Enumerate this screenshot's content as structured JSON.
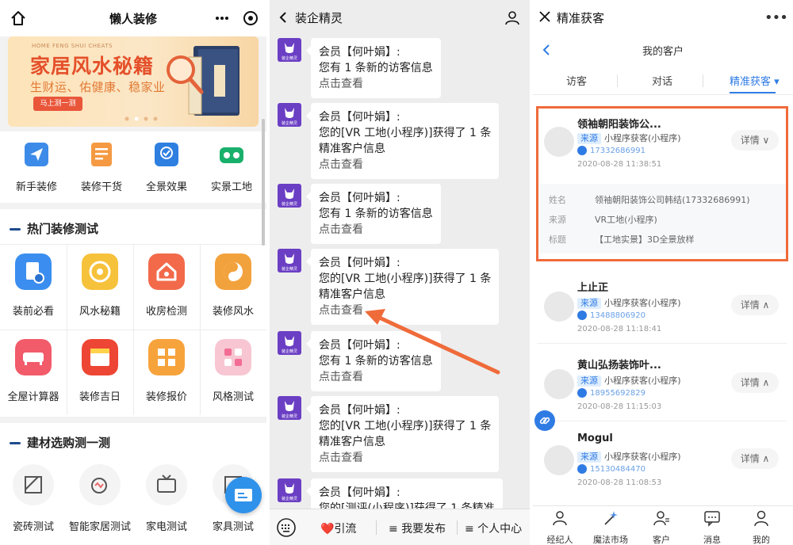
{
  "colors": {
    "accent_blue": "#2f7be4",
    "highlight_orange": "#ef6b3a",
    "banner_red": "#e4502a",
    "chat_avatar": "#6b3fc4"
  },
  "panel1": {
    "title": "懒人装修",
    "banner": {
      "small_text": "HOME FENG SHUI CHEATS",
      "title": "家居风水秘籍",
      "subtitle": "生财运、佑健康、稳家业",
      "button": "马上测一测"
    },
    "quick_links": [
      {
        "label": "新手装修",
        "icon": "paper-plane-icon"
      },
      {
        "label": "装修干货",
        "icon": "document-icon"
      },
      {
        "label": "全景效果",
        "icon": "panorama-icon"
      },
      {
        "label": "实景工地",
        "icon": "vr-glasses-icon"
      }
    ],
    "section1": {
      "title": "热门装修测试",
      "items": [
        {
          "label": "装前必看",
          "icon": "checklist-icon"
        },
        {
          "label": "风水秘籍",
          "icon": "compass-icon"
        },
        {
          "label": "收房检测",
          "icon": "house-icon"
        },
        {
          "label": "装修风水",
          "icon": "yinyang-icon"
        },
        {
          "label": "全屋计算器",
          "icon": "sofa-icon"
        },
        {
          "label": "装修吉日",
          "icon": "calendar-icon"
        },
        {
          "label": "装修报价",
          "icon": "calculator-icon"
        },
        {
          "label": "风格测试",
          "icon": "grid-icon"
        }
      ]
    },
    "section2": {
      "title": "建材选购测一测",
      "items": [
        {
          "label": "瓷砖测试",
          "icon": "tile-icon"
        },
        {
          "label": "智能家居测试",
          "icon": "smart-home-icon"
        },
        {
          "label": "家电测试",
          "icon": "tv-icon"
        },
        {
          "label": "家具测试",
          "icon": "furniture-icon"
        }
      ]
    }
  },
  "panel2": {
    "title": "装企精灵",
    "avatar_label": "装企精灵",
    "messages": [
      {
        "line1": "会员【何叶娟】:",
        "line2": "您有 1 条新的访客信息",
        "line3": "",
        "link": "点击查看"
      },
      {
        "line1": "会员【何叶娟】:",
        "line2": "您的[VR 工地(小程序)]获得了 1 条",
        "line3": "精准客户信息",
        "link": "点击查看"
      },
      {
        "line1": "会员【何叶娟】:",
        "line2": "您有 1 条新的访客信息",
        "line3": "",
        "link": "点击查看"
      },
      {
        "line1": "会员【何叶娟】:",
        "line2": "您的[VR 工地(小程序)]获得了 1 条",
        "line3": "精准客户信息",
        "link": "点击查看"
      },
      {
        "line1": "会员【何叶娟】:",
        "line2": "您有 1 条新的访客信息",
        "line3": "",
        "link": "点击查看"
      },
      {
        "line1": "会员【何叶娟】:",
        "line2": "您的[VR 工地(小程序)]获得了 1 条",
        "line3": "精准客户信息",
        "link": "点击查看"
      },
      {
        "line1": "会员【何叶娟】:",
        "line2": "您的[测评(小程序)]获得了 1 条精准",
        "line3": "",
        "link": ""
      }
    ],
    "footer": {
      "item1": "❤️引流",
      "item2": "≡ 我要发布",
      "item3": "≡ 个人中心"
    }
  },
  "panel3": {
    "title": "精准获客",
    "subtitle": "我的客户",
    "tabs": [
      "访客",
      "对话",
      "精准获客 ▾"
    ],
    "customers": [
      {
        "name": "领袖朝阳装饰公...",
        "source_tag": "来源",
        "source": "小程序获客(小程序)",
        "phone": "17332686991",
        "time": "2020-08-28 11:38:51",
        "detail": "详情 ∨"
      },
      {
        "name": "上止正",
        "source_tag": "来源",
        "source": "小程序获客(小程序)",
        "phone": "13488806920",
        "time": "2020-08-28 11:18:41",
        "detail": "详情 ∧"
      },
      {
        "name": "黄山弘扬装饰叶...",
        "source_tag": "来源",
        "source": "小程序获客(小程序)",
        "phone": "18955692829",
        "time": "2020-08-28 11:15:03",
        "detail": "详情 ∧"
      },
      {
        "name": "Mogul",
        "source_tag": "来源",
        "source": "小程序获客(小程序)",
        "phone": "15130484470",
        "time": "2020-08-28 11:08:53",
        "detail": "详情 ∧"
      }
    ],
    "expanded_info": [
      {
        "key": "姓名",
        "value": "领袖朝阳装饰公司韩结(17332686991)"
      },
      {
        "key": "来源",
        "value": "VR工地(小程序)"
      },
      {
        "key": "标题",
        "value": "【工地实景】3D全景放样"
      }
    ],
    "footer": [
      "经纪人",
      "魔法市场",
      "客户",
      "消息",
      "我的"
    ]
  }
}
